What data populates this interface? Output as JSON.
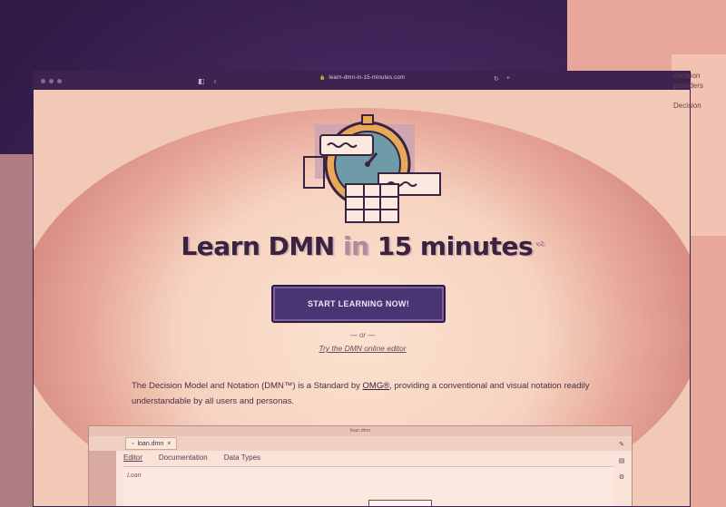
{
  "browser": {
    "url": "learn-dmn-in-15-minutes.com"
  },
  "hero": {
    "title_part1": "Learn DMN ",
    "title_in": "in",
    "title_part2": " 15 minutes",
    "version": "v2"
  },
  "cta": {
    "start_label": "START LEARNING NOW!",
    "or_text": "— or —",
    "editor_link": "Try the DMN online editor"
  },
  "intro": {
    "text_before": "The Decision Model and Notation (DMN™) is a Standard by ",
    "link": "OMG®",
    "text_after": ", providing a conventional and visual notation readily understandable by all users and personas."
  },
  "editor": {
    "window_title": "loan.dmn",
    "file_tab": "loan.dmn",
    "tabs": [
      "Editor",
      "Documentation",
      "Data Types"
    ],
    "canvas_label": "Loan"
  },
  "background": {
    "right_text": "decision\nproviders\n\nDecision"
  },
  "colors": {
    "accent": "#4a3474",
    "background": "#f2c9b7",
    "text": "#3a2340"
  }
}
